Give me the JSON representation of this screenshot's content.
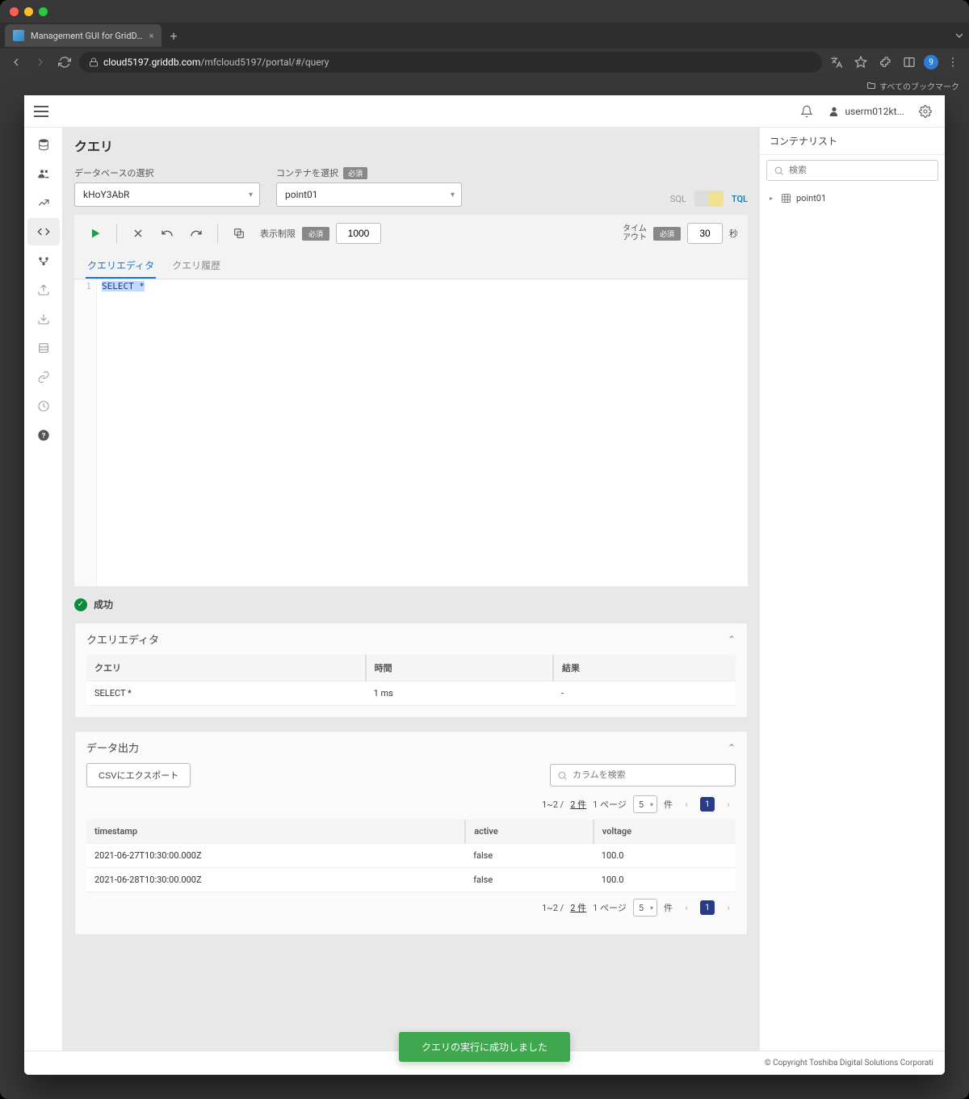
{
  "browser": {
    "tab_title": "Management GUI for GridD…",
    "url_host": "cloud5197.griddb.com",
    "url_path": "/mfcloud5197/portal/#/query",
    "bookmarks_label": "すべてのブックマーク",
    "profile_badge": "9"
  },
  "header": {
    "username": "userm012kt..."
  },
  "page": {
    "title": "クエリ"
  },
  "db_select": {
    "label": "データベースの選択",
    "value": "kHoY3AbR"
  },
  "container_select": {
    "label": "コンテナを選択",
    "required": "必須",
    "value": "point01"
  },
  "mode": {
    "sql": "SQL",
    "tql": "TQL"
  },
  "toolbar": {
    "display_limit_label": "表示制限",
    "display_limit_required": "必須",
    "display_limit_value": "1000",
    "timeout_line1": "タイム",
    "timeout_line2": "アウト",
    "timeout_required": "必須",
    "timeout_value": "30",
    "timeout_unit": "秒"
  },
  "editor_tabs": {
    "editor": "クエリエディタ",
    "history": "クエリ履歴"
  },
  "editor": {
    "line_no": "1",
    "code": "SELECT *"
  },
  "status": {
    "text": "成功"
  },
  "query_panel": {
    "title": "クエリエディタ",
    "cols": {
      "query": "クエリ",
      "time": "時間",
      "result": "結果"
    },
    "row": {
      "query": "SELECT *",
      "time": "1 ms",
      "result": "-"
    }
  },
  "data_panel": {
    "title": "データ出力",
    "export": "CSVにエクスポート",
    "col_search_placeholder": "カラムを検索",
    "pager": {
      "range": "1~2 / ",
      "total": "2 件",
      "per_page_label_pre": "1 ページ",
      "per_page_value": "5",
      "per_page_label_post": "件",
      "page_no": "1"
    },
    "columns": [
      "timestamp",
      "active",
      "voltage"
    ],
    "rows": [
      {
        "timestamp": "2021-06-27T10:30:00.000Z",
        "active": "false",
        "voltage": "100.0"
      },
      {
        "timestamp": "2021-06-28T10:30:00.000Z",
        "active": "false",
        "voltage": "100.0"
      }
    ]
  },
  "right_panel": {
    "title": "コンテナリスト",
    "search_placeholder": "検索",
    "item": "point01"
  },
  "toast": "クエリの実行に成功しました",
  "footer": "© Copyright Toshiba Digital Solutions Corporati"
}
